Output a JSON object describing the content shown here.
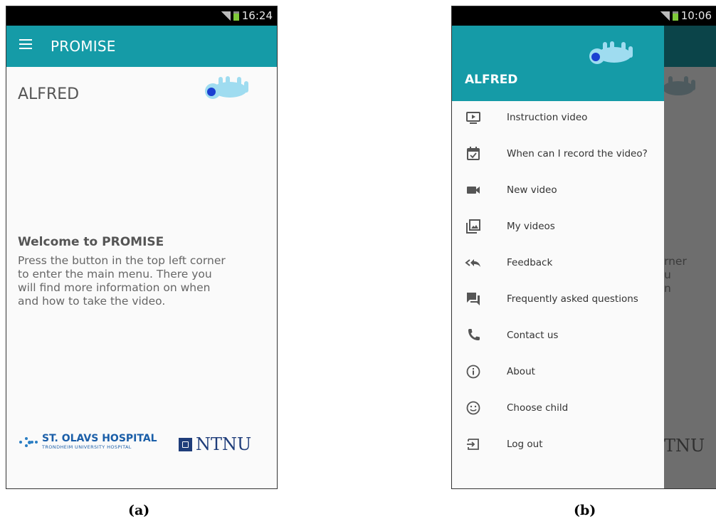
{
  "screen_a": {
    "status_time": "16:24",
    "app_title": "PROMISE",
    "child_name": "ALFRED",
    "welcome_title": "Welcome to PROMISE",
    "welcome_lines": [
      "Press the button in the top left corner",
      "to enter the main menu. There you",
      "will find more information on when",
      "and how to take the video."
    ],
    "logo_hospital_name": "ST. OLAVS HOSPITAL",
    "logo_hospital_sub": "TRONDHEIM UNIVERSITY HOSPITAL",
    "logo_university": "NTNU",
    "caption": "(a)"
  },
  "screen_b": {
    "status_time": "10:06",
    "drawer_name": "ALFRED",
    "menu_items": [
      {
        "label": "Instruction video",
        "icon": "play-video-icon"
      },
      {
        "label": "When can I record the video?",
        "icon": "calendar-check-icon"
      },
      {
        "label": "New video",
        "icon": "video-camera-icon"
      },
      {
        "label": "My videos",
        "icon": "photo-library-icon"
      },
      {
        "label": "Feedback",
        "icon": "reply-all-icon"
      },
      {
        "label": "Frequently asked questions",
        "icon": "forum-icon"
      },
      {
        "label": "Contact us",
        "icon": "phone-icon"
      },
      {
        "label": "About",
        "icon": "info-icon"
      },
      {
        "label": "Choose child",
        "icon": "smiley-face-icon"
      },
      {
        "label": "Log out",
        "icon": "exit-icon"
      }
    ],
    "background_text_lines": [
      "rner",
      "u",
      "n"
    ],
    "background_logo": "TNU",
    "caption": "(b)"
  },
  "colors": {
    "accent": "#159ba7",
    "accent_dark": "#0b4449",
    "scrim": "#6e6e6e",
    "baby_icon": "#9fdcf0",
    "baby_head": "#1a3fd1"
  }
}
